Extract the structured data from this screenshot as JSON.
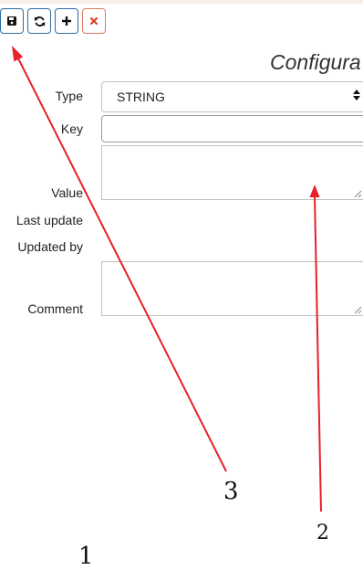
{
  "toolbar": {
    "buttons": [
      {
        "name": "save-button",
        "icon": "floppy-disk-icon"
      },
      {
        "name": "refresh-button",
        "icon": "refresh-icon"
      },
      {
        "name": "add-button",
        "icon": "plus-icon"
      },
      {
        "name": "delete-button",
        "icon": "close-icon"
      }
    ],
    "accent": "#2e6da4",
    "danger": "#e07a5f"
  },
  "page": {
    "title": "Configura"
  },
  "form": {
    "type_label": "Type",
    "type_value": "STRING",
    "key_label": "Key",
    "key_value": "",
    "value_label": "Value",
    "value_value": "",
    "last_update_label": "Last update",
    "last_update_value": "",
    "updated_by_label": "Updated by",
    "updated_by_value": "",
    "comment_label": "Comment",
    "comment_value": ""
  },
  "annotations": {
    "labels": [
      "3",
      "2",
      "1"
    ],
    "color": "#e8202a"
  }
}
